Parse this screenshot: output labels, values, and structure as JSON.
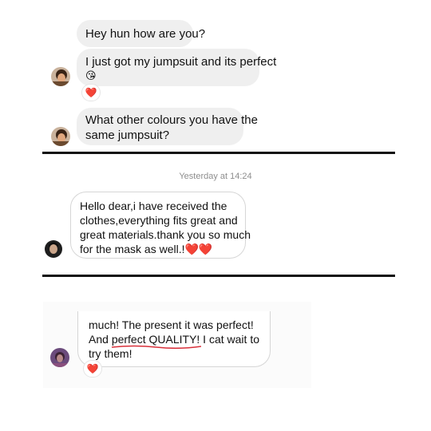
{
  "section1": {
    "messages": [
      {
        "text": "Hey hun how are you?"
      },
      {
        "line1": "I just got my jumpsuit and its perfect",
        "emoji": "😘",
        "reaction": "❤️"
      },
      {
        "line1": "What other colours you have the",
        "line2": "same jumpsuit?"
      }
    ]
  },
  "section2": {
    "timestamp": "Yesterday at 14:24",
    "message": {
      "line1": "Hello dear,i have received the",
      "line2": "clothes,everything fits great and",
      "line3": "great materials.thank you so much",
      "line4": "for the mask as well.!",
      "hearts": "❤️❤️"
    }
  },
  "section3": {
    "message": {
      "line1": "much! The present it was perfect!",
      "line2_pre": "And ",
      "line2_underlined": "perfect QUALITY!",
      "line2_post": " I cat wait to",
      "line3": "try them!",
      "reaction": "❤️"
    }
  },
  "colors": {
    "bubble_gray": "#efefef",
    "divider": "#111111",
    "heart": "#e0243a",
    "underline": "#d9303a"
  }
}
